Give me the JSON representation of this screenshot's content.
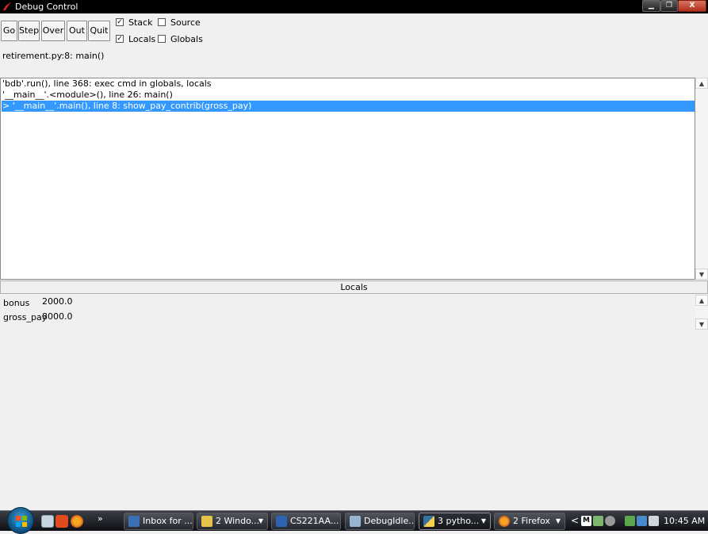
{
  "window": {
    "title": "Debug Control",
    "controls": {
      "minimize": "▁",
      "maximize": "❐",
      "close": "X"
    }
  },
  "toolbar": {
    "buttons": [
      "Go",
      "Step",
      "Over",
      "Out",
      "Quit"
    ]
  },
  "options": [
    {
      "label": "Stack",
      "checked": true
    },
    {
      "label": "Source",
      "checked": false
    },
    {
      "label": "Locals",
      "checked": true
    },
    {
      "label": "Globals",
      "checked": false
    }
  ],
  "status": "retirement.py:8: main()",
  "stack": {
    "frames": [
      "'bdb'.run(), line 368: exec cmd in globals, locals",
      "'__main__'.<module>(), line 26: main()",
      "> '__main__'.main(), line 8: show_pay_contrib(gross_pay)"
    ],
    "selected_index": 2
  },
  "locals": {
    "header": "Locals",
    "vars": [
      {
        "name": "bonus",
        "value": "2000.0"
      },
      {
        "name": "gross_pay",
        "value": "8000.0"
      }
    ]
  },
  "taskbar": {
    "quick_launch_more": "»",
    "tasks": [
      {
        "label": "Inbox for ..."
      },
      {
        "label": "2 Windo..."
      },
      {
        "label": "CS221AA..."
      },
      {
        "label": "DebugIdle..."
      },
      {
        "label": "3 pytho..."
      },
      {
        "label": "2 Firefox"
      }
    ],
    "tray_arrow": "<",
    "tray_m": "M",
    "clock": "10:45 AM"
  },
  "colors": {
    "selection": "#3399ff",
    "titlebar": "#000000",
    "window_bg": "#f0f0f0"
  }
}
